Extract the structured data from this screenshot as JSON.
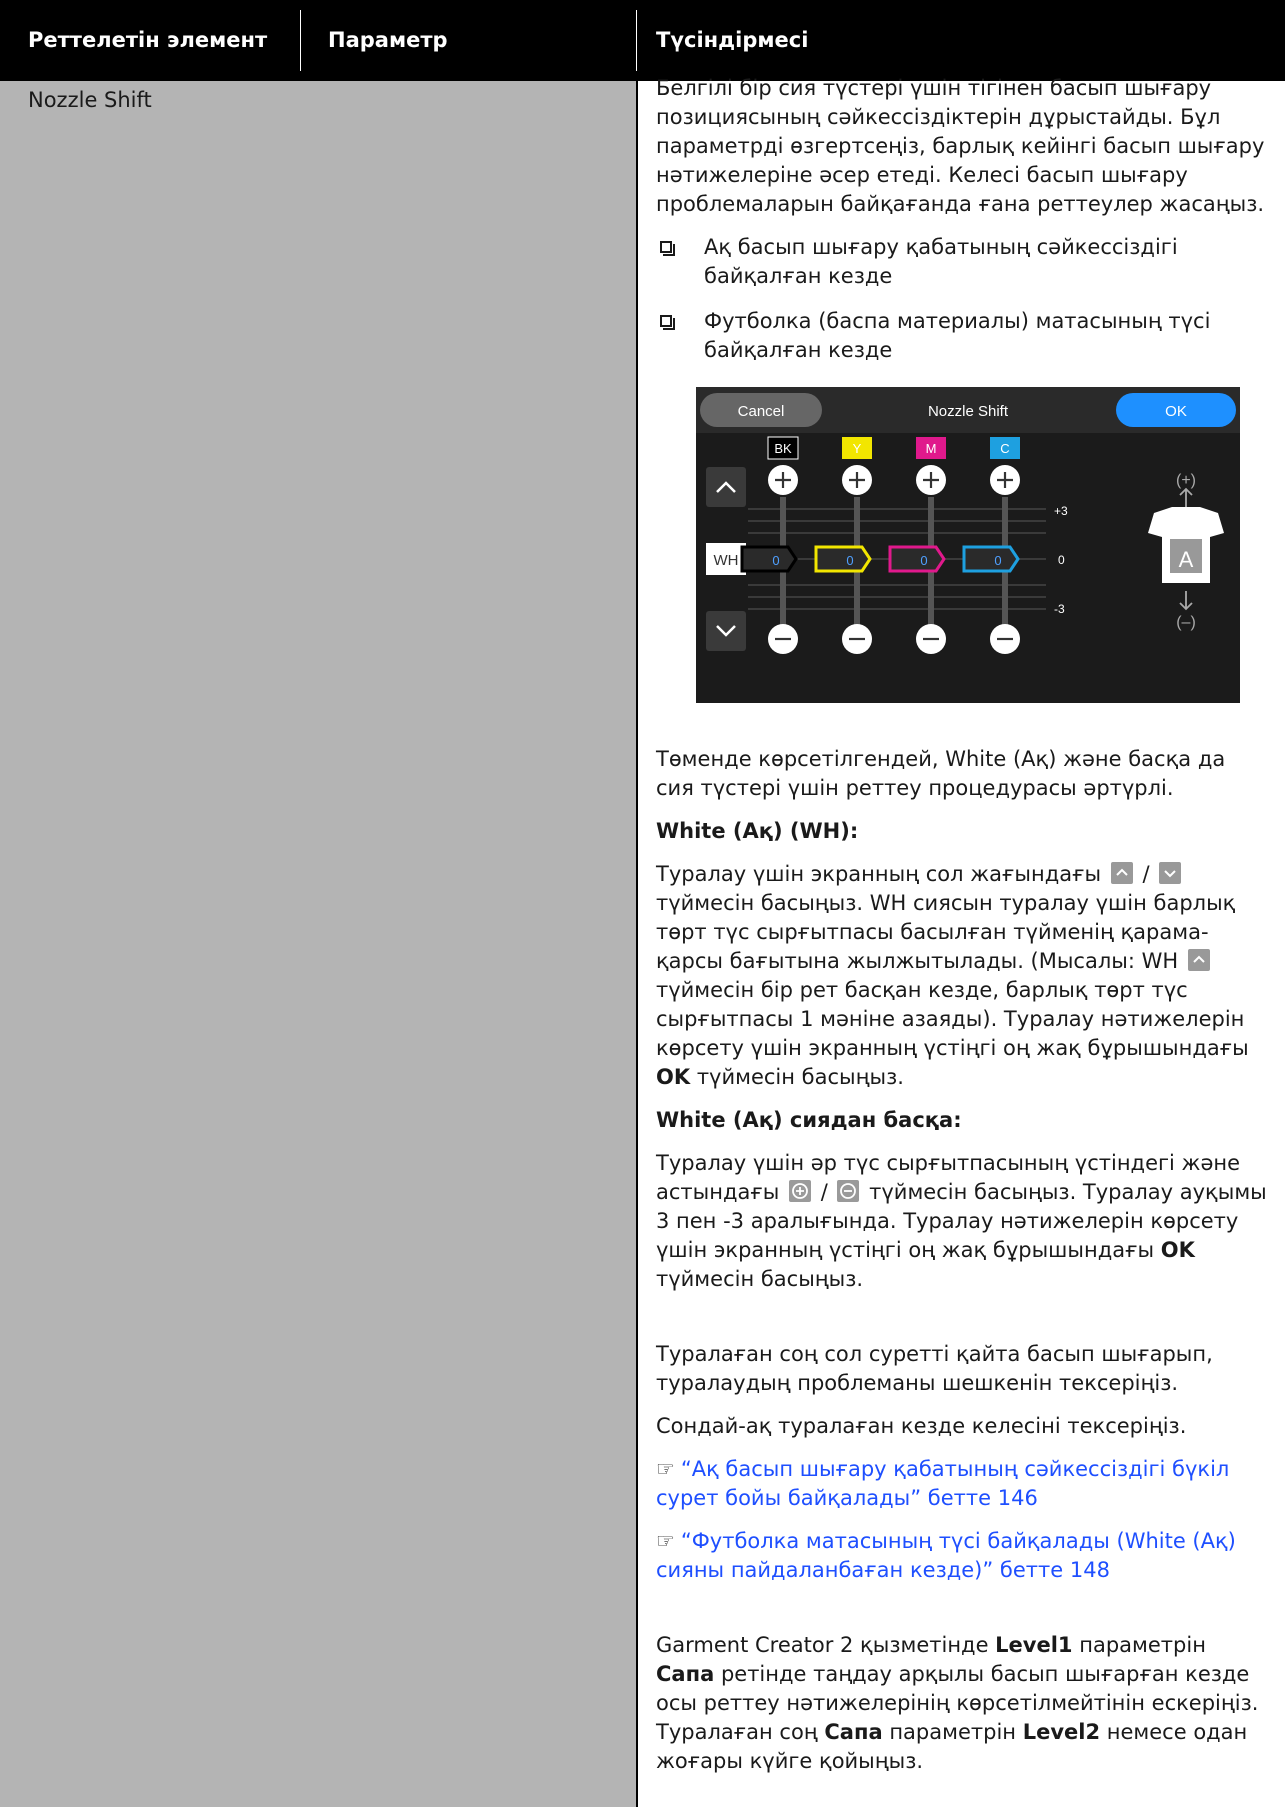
{
  "header": {
    "col1": "Реттелетін элемент",
    "col2": "Параметр",
    "col3": "Түсіндірмесі"
  },
  "setting_name": "Nozzle Shift",
  "desc": {
    "intro": "Белгілі бір сия түстері үшін тігінен басып шығару позициясының сәйкессіздіктерін дұрыстайды. Бұл параметрді өзгертсеңіз, барлық кейінгі басып шығару нәтижелеріне әсер етеді. Келесі басып шығару проблемаларын байқағанда ғана реттеулер жасаңыз.",
    "bullets": [
      "Ақ басып шығару қабатының сәйкессіздігі байқалған кезде",
      "Футболка (баспа материалы) матасының түсі байқалған кезде"
    ],
    "differs": "Төменде көрсетілгендей, White (Ақ) және басқа да сия түстері үшін реттеу процедурасы әртүрлі.",
    "white_heading": "White (Ақ) (WH):",
    "white_p1": "Туралау үшін экранның сол жағындағы",
    "white_p2": "түймесін басыңыз. WH сиясын туралау үшін барлық төрт түс сырғытпасы басылған түйменің қарама-қарсы бағытына жылжытылады. (Мысалы: WH",
    "white_p3": "түймесін бір рет басқан кезде, барлық төрт түс сырғытпасы 1 мәніне азаяды). Туралау нәтижелерін көрсету үшін экранның үстіңгі оң жақ бұрышындағы",
    "white_ok": "OK",
    "white_p4": "түймесін басыңыз.",
    "other_heading": "White (Ақ) сиядан басқа:",
    "other_p1": "Туралау үшін әр түс сырғытпасының үстіндегі және астындағы",
    "other_p2": "түймесін басыңыз. Туралау ауқымы 3 пен -3 аралығында. Туралау нәтижелерін көрсету үшін экранның үстіңгі оң жақ бұрышындағы",
    "other_ok": "OK",
    "other_p3": "түймесін басыңыз.",
    "after1": "Туралаған соң сол суретті қайта басып шығарып, туралаудың проблеманы шешкенін тексеріңіз.",
    "after2": "Сондай-ақ туралаған кезде келесіні тексеріңіз.",
    "link1": "“Ақ басып шығару қабатының сәйкессіздігі бүкіл сурет бойы байқалады” бетте 146",
    "link2": "“Футболка матасының түсі байқалады (White (Ақ) сияны пайдаланбаған кезде)” бетте 148",
    "note_a": "Garment Creator 2 қызметінде",
    "note_level1": "Level1",
    "note_b": "параметрін",
    "note_sapa1": "Сапа",
    "note_c": "ретінде таңдау арқылы басып шығарған кезде осы реттеу нәтижелерінің көрсетілмейтінін ескеріңіз. Туралаған соң",
    "note_sapa2": "Сапа",
    "note_d": "параметрін",
    "note_level2": "Level2",
    "note_e": "немесе одан жоғары күйге қойыңыз."
  },
  "screen": {
    "cancel": "Cancel",
    "title": "Nozzle Shift",
    "ok": "OK",
    "wh": "WH",
    "scale_top": "+3",
    "scale_mid": "0",
    "scale_bot": "-3",
    "plus_label": "(+)",
    "minus_label": "(–)",
    "shirt_letter": "A",
    "channels": [
      {
        "label": "BK",
        "value": "0",
        "color": "#000000"
      },
      {
        "label": "Y",
        "value": "0",
        "color": "#f2e600"
      },
      {
        "label": "M",
        "value": "0",
        "color": "#e0198c"
      },
      {
        "label": "C",
        "value": "0",
        "color": "#1ea0e0"
      }
    ],
    "colors": {
      "bg": "#1b1b1b",
      "bar": "#333333",
      "ok_btn": "#1e90ff",
      "cancel_btn": "#666666"
    }
  }
}
